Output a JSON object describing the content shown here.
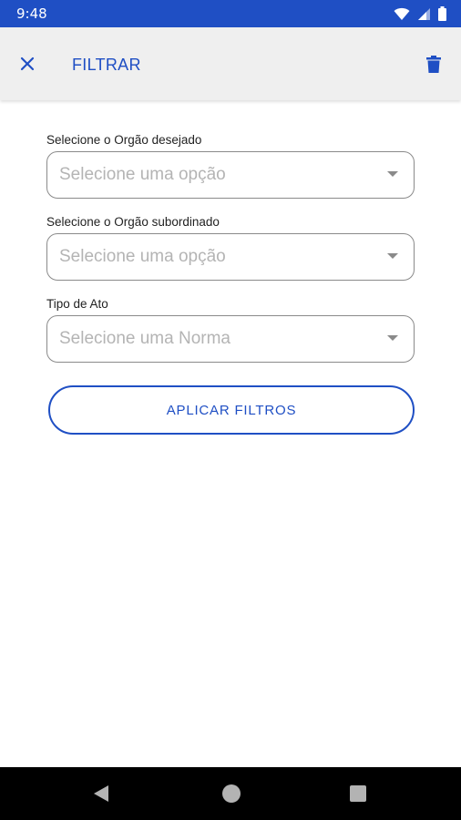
{
  "status_bar": {
    "time": "9:48",
    "icons": [
      "wifi-icon",
      "signal-icon",
      "battery-icon"
    ]
  },
  "app_bar": {
    "title": "FILTRAR",
    "close_icon": "close-icon",
    "delete_icon": "trash-icon"
  },
  "form": {
    "fields": [
      {
        "label": "Selecione o Orgão desejado",
        "placeholder": "Selecione uma opção"
      },
      {
        "label": "Selecione o Orgão subordinado",
        "placeholder": "Selecione uma opção"
      },
      {
        "label": "Tipo de Ato",
        "placeholder": "Selecione uma Norma"
      }
    ],
    "apply_label": "APLICAR FILTROS"
  },
  "nav_bar": {
    "icons": [
      "back-icon",
      "home-icon",
      "recents-icon"
    ]
  },
  "colors": {
    "primary": "#1f4fc4",
    "app_bar_bg": "#efefef",
    "border": "#8a8a8a",
    "placeholder": "#b4b4b4"
  }
}
